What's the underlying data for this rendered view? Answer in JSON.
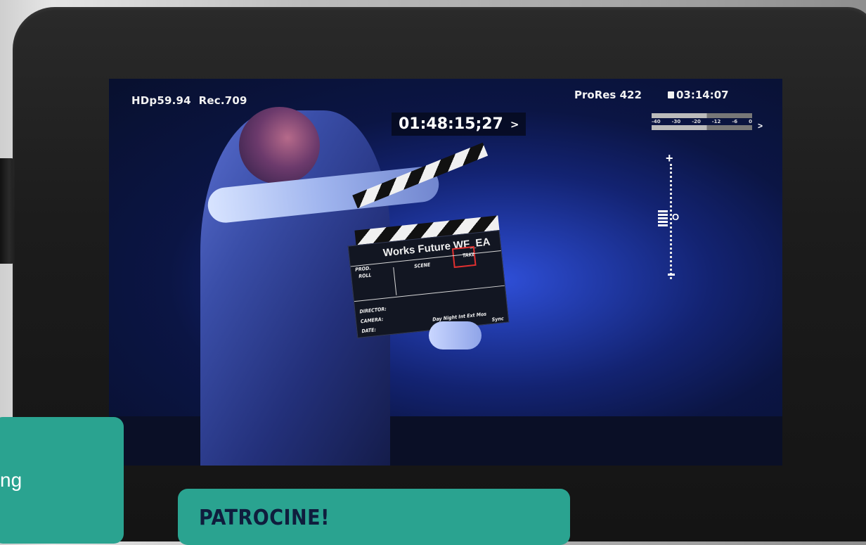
{
  "monitor": {
    "format": "HDp59.94",
    "colorspace": "Rec.709",
    "codec": "ProRes 422",
    "remaining_time": "03:14:07",
    "timecode": "01:48:15;27",
    "timecode_arrow": ">",
    "meter_scale": [
      "-40",
      "-30",
      "-20",
      "-12",
      "-6",
      "0"
    ],
    "meter_arrow": ">",
    "audio_plus": "+",
    "audio_zero": "O"
  },
  "slate": {
    "title": "Works Future WF_EA",
    "labels": {
      "prod": "PROD.",
      "roll": "ROLL",
      "scene": "SCENE",
      "take": "TAKE",
      "director": "DIRECTOR:",
      "camera": "CAMERA:",
      "date": "DATE:",
      "footer": "Day Night Int Ext Mos",
      "sync": "Sync"
    }
  },
  "overlay": {
    "left_card_text": "ng",
    "bottom_card_title": "PATROCINE!"
  }
}
